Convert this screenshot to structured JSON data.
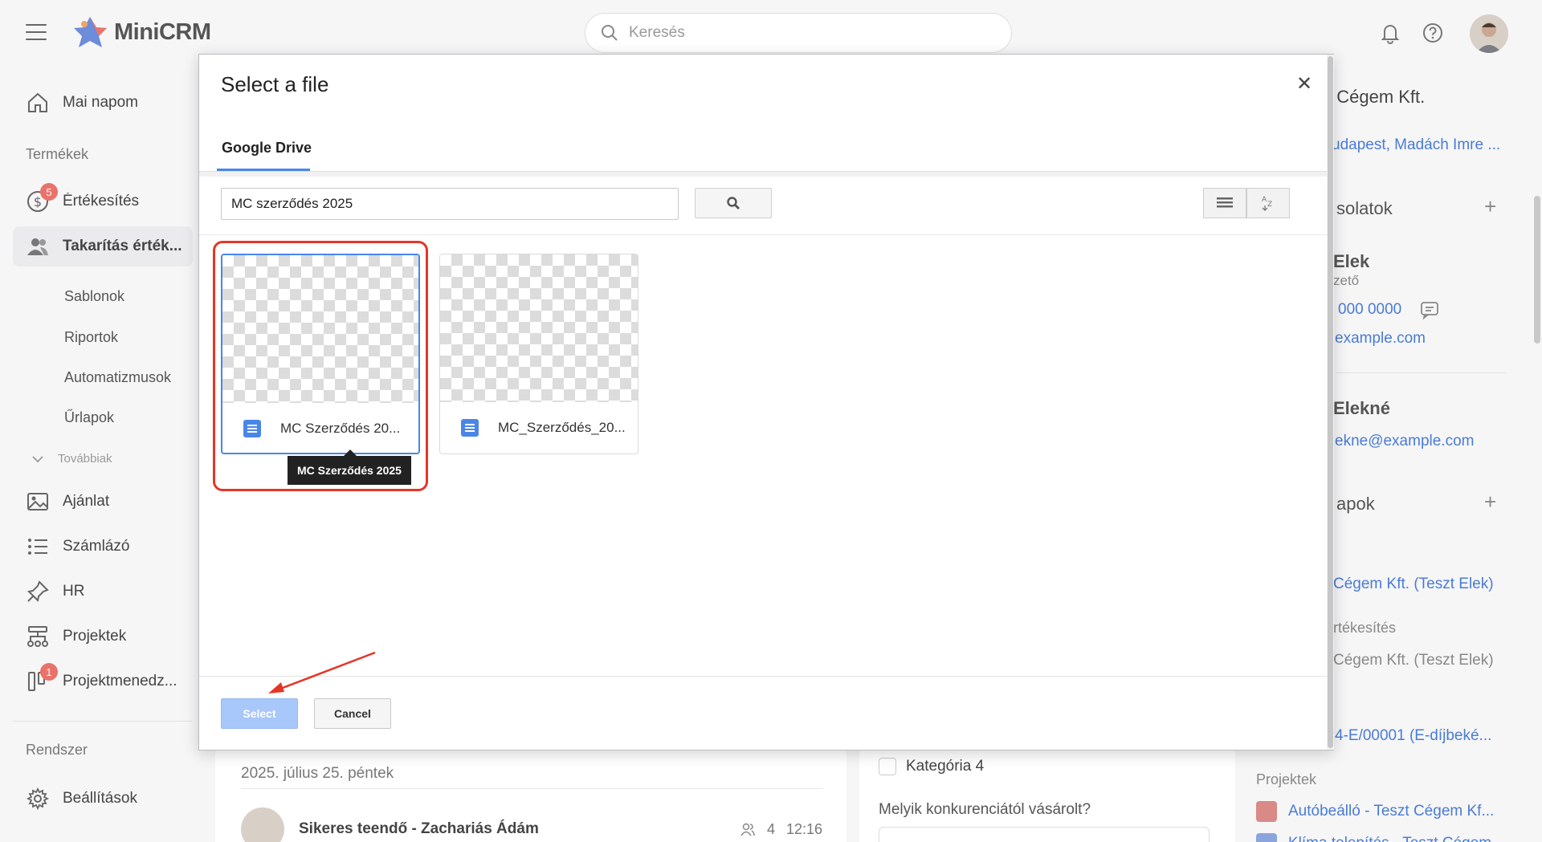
{
  "app": {
    "brand": "MiniCRM",
    "search_placeholder": "Keresés"
  },
  "sidebar": {
    "home": "Mai napom",
    "section_products": "Termékek",
    "sales": "Értékesítés",
    "sales_badge": "5",
    "cleaning": "Takarítás érték...",
    "sub_items": [
      "Sablonok",
      "Riportok",
      "Automatizmusok",
      "Űrlapok"
    ],
    "more": "Továbbiak",
    "offer": "Ajánlat",
    "invoicing": "Számlázó",
    "hr": "HR",
    "projects": "Projektek",
    "project_mgmt": "Projektmenedz...",
    "project_mgmt_badge": "1",
    "section_system": "Rendszer",
    "settings": "Beállítások"
  },
  "background": {
    "date": "2025. július 25. péntek",
    "task_title": "Sikeres teendő - Zachariás Ádám",
    "task_count": "4",
    "task_time": "12:16",
    "category": "Kategória 4",
    "question": "Melyik konkurenciától vásárolt?"
  },
  "right_panel": {
    "company_title": ": Cégem Kft.",
    "address": "udapest, Madách Imre ...",
    "contacts_head": "solatok",
    "person1_name": "Elek",
    "person1_role": "zető",
    "person1_phone": "000 0000",
    "person1_email": "example.com",
    "person2_name": "Elekné",
    "person2_email": "ekne@example.com",
    "adatlapok_head": "apok",
    "link1": "Cégem Kft. (Teszt Elek)",
    "sales_label": "rtékesítés",
    "muted1": "Cégem Kft. (Teszt Elek)",
    "invoice_link": "4-E/00001 (E-díjbeké...",
    "projects_label": "Projektek",
    "project1": "Autóbeálló - Teszt Cégem Kf...",
    "project2": "Klíma telepítés - Teszt Cégem"
  },
  "dialog": {
    "title": "Select a file",
    "tab": "Google Drive",
    "search_value": "MC szerződés 2025",
    "files": [
      {
        "name": "MC Szerződés 20...",
        "selected": true
      },
      {
        "name": "MC_Szerződés_20...",
        "selected": false
      }
    ],
    "tooltip": "MC Szerződés 2025",
    "select_label": "Select",
    "cancel_label": "Cancel"
  },
  "colors": {
    "accent": "#4a86e8",
    "highlight": "#e53528",
    "badge": "#e9726a",
    "link": "#4a7bd6"
  }
}
